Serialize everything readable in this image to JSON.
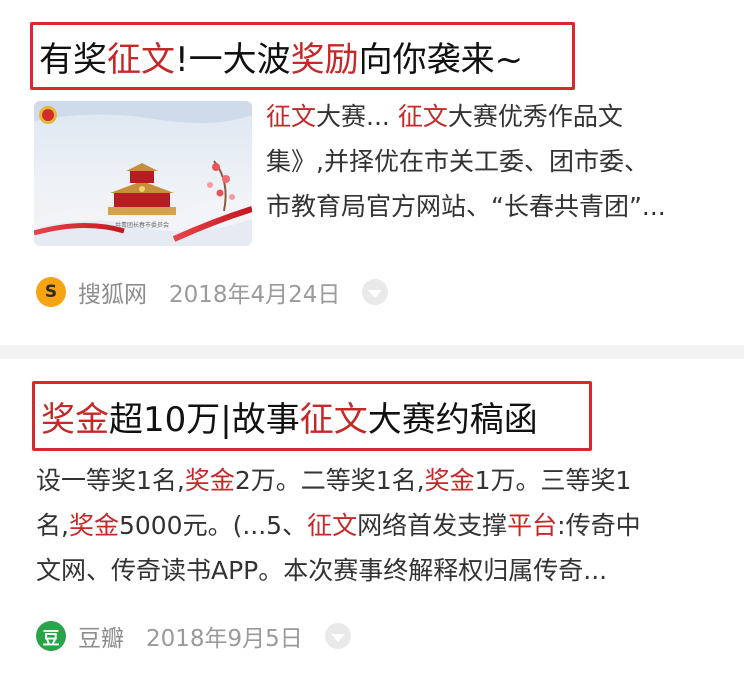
{
  "results": [
    {
      "title_parts": [
        {
          "text": "有奖",
          "hl": false
        },
        {
          "text": "征文",
          "hl": true
        },
        {
          "text": "!一大波",
          "hl": false
        },
        {
          "text": "奖励",
          "hl": true
        },
        {
          "text": "向你袭来~",
          "hl": false
        }
      ],
      "thumbnail_caption": "共青团长春市委员会",
      "snippet_lines": [
        [
          {
            "text": "征文",
            "hl": true
          },
          {
            "text": "大赛... ",
            "hl": false
          },
          {
            "text": "征文",
            "hl": true
          },
          {
            "text": "大赛优秀作品文",
            "hl": false
          }
        ],
        [
          {
            "text": "集》,并择优在市关工委、团市委、",
            "hl": false
          }
        ],
        [
          {
            "text": "市教育局官方网站、“长春共青团”...",
            "hl": false
          }
        ]
      ],
      "source": "搜狐网",
      "source_icon": "sohu-logo-icon",
      "source_icon_glyph": "S",
      "date": "2018年4月24日"
    },
    {
      "title_parts": [
        {
          "text": "奖金",
          "hl": true
        },
        {
          "text": "超10万|故事",
          "hl": false
        },
        {
          "text": "征文",
          "hl": true
        },
        {
          "text": "大赛约稿函",
          "hl": false
        }
      ],
      "snippet_lines": [
        [
          {
            "text": "设一等奖1名,",
            "hl": false
          },
          {
            "text": "奖金",
            "hl": true
          },
          {
            "text": "2万。二等奖1名,",
            "hl": false
          },
          {
            "text": "奖金",
            "hl": true
          },
          {
            "text": "1万。三等奖1",
            "hl": false
          }
        ],
        [
          {
            "text": "名,",
            "hl": false
          },
          {
            "text": "奖金",
            "hl": true
          },
          {
            "text": "5000元。(...5、",
            "hl": false
          },
          {
            "text": "征文",
            "hl": true
          },
          {
            "text": "网络首发支撑",
            "hl": false
          },
          {
            "text": "平台",
            "hl": true
          },
          {
            "text": ":传奇中",
            "hl": false
          }
        ],
        [
          {
            "text": "文网、传奇读书APP。本次赛事终解释权归属传奇...",
            "hl": false
          }
        ]
      ],
      "source": "豆瓣",
      "source_icon": "douban-logo-icon",
      "source_icon_glyph": "豆",
      "date": "2018年9月5日"
    }
  ],
  "colors": {
    "highlight": "#c62828",
    "title_border": "#d9272e",
    "divider": "#f2f2f2",
    "sohu": "#f6a314",
    "douban": "#2aa34a"
  },
  "icons": {
    "more": "chevron-down-icon"
  }
}
